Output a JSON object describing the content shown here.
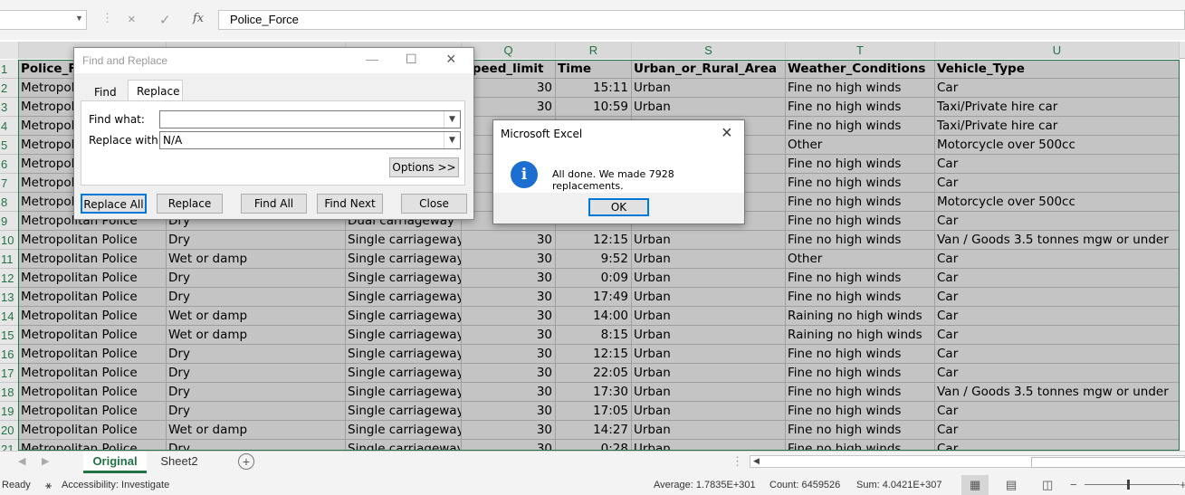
{
  "formula_bar": {
    "name_box_value": "",
    "formula_value": "Police_Force",
    "cancel_icon": "×",
    "enter_icon": "✓",
    "fx_icon": "fx"
  },
  "columns": [
    {
      "letter": "",
      "label": ""
    },
    {
      "letter": "",
      "label": ""
    },
    {
      "letter": "",
      "label": ""
    },
    {
      "letter": "Q",
      "label": "Q"
    },
    {
      "letter": "R",
      "label": "R"
    },
    {
      "letter": "S",
      "label": "S"
    },
    {
      "letter": "T",
      "label": "T"
    },
    {
      "letter": "U",
      "label": "U"
    }
  ],
  "header_row": [
    "Police_Force",
    "",
    "",
    "Speed_limit",
    "Time",
    "Urban_or_Rural_Area",
    "Weather_Conditions",
    "Vehicle_Type"
  ],
  "rows": [
    {
      "n": "2",
      "a": "Metropolitan Police",
      "b": "",
      "c": "",
      "speed": "30",
      "time": "15:11",
      "area": "Urban",
      "weather": "Fine no high winds",
      "vehicle": "Car"
    },
    {
      "n": "3",
      "a": "Metropolitan Police",
      "b": "",
      "c": "",
      "speed": "30",
      "time": "10:59",
      "area": "Urban",
      "weather": "Fine no high winds",
      "vehicle": "Taxi/Private hire car"
    },
    {
      "n": "4",
      "a": "Metropolitan Police",
      "b": "",
      "c": "",
      "speed": "",
      "time": "",
      "area": "",
      "weather": "Fine no high winds",
      "vehicle": "Taxi/Private hire car"
    },
    {
      "n": "5",
      "a": "Metropolitan Police",
      "b": "",
      "c": "",
      "speed": "",
      "time": "",
      "area": "",
      "weather": "Other",
      "vehicle": "Motorcycle over 500cc"
    },
    {
      "n": "6",
      "a": "Metropolitan Police",
      "b": "",
      "c": "",
      "speed": "",
      "time": "",
      "area": "",
      "weather": "Fine no high winds",
      "vehicle": "Car"
    },
    {
      "n": "7",
      "a": "Metropolitan Police",
      "b": "",
      "c": "",
      "speed": "",
      "time": "",
      "area": "",
      "weather": "Fine no high winds",
      "vehicle": "Car"
    },
    {
      "n": "8",
      "a": "Metropolitan Police",
      "b": "",
      "c": "",
      "speed": "",
      "time": "",
      "area": "",
      "weather": "Fine no high winds",
      "vehicle": "Motorcycle over 500cc"
    },
    {
      "n": "9",
      "a": "Metropolitan Police",
      "b": "Dry",
      "c": "Dual carriageway",
      "speed": "30",
      "time": "15:18",
      "area": "Urban",
      "weather": "Fine no high winds",
      "vehicle": "Car"
    },
    {
      "n": "10",
      "a": "Metropolitan Police",
      "b": "Dry",
      "c": "Single carriageway",
      "speed": "30",
      "time": "12:15",
      "area": "Urban",
      "weather": "Fine no high winds",
      "vehicle": "Van / Goods 3.5 tonnes mgw or under"
    },
    {
      "n": "11",
      "a": "Metropolitan Police",
      "b": "Wet or damp",
      "c": "Single carriageway",
      "speed": "30",
      "time": "9:52",
      "area": "Urban",
      "weather": "Other",
      "vehicle": "Car"
    },
    {
      "n": "12",
      "a": "Metropolitan Police",
      "b": "Dry",
      "c": "Single carriageway",
      "speed": "30",
      "time": "0:09",
      "area": "Urban",
      "weather": "Fine no high winds",
      "vehicle": "Car"
    },
    {
      "n": "13",
      "a": "Metropolitan Police",
      "b": "Dry",
      "c": "Single carriageway",
      "speed": "30",
      "time": "17:49",
      "area": "Urban",
      "weather": "Fine no high winds",
      "vehicle": "Car"
    },
    {
      "n": "14",
      "a": "Metropolitan Police",
      "b": "Wet or damp",
      "c": "Single carriageway",
      "speed": "30",
      "time": "14:00",
      "area": "Urban",
      "weather": "Raining no high winds",
      "vehicle": "Car"
    },
    {
      "n": "15",
      "a": "Metropolitan Police",
      "b": "Wet or damp",
      "c": "Single carriageway",
      "speed": "30",
      "time": "8:15",
      "area": "Urban",
      "weather": "Raining no high winds",
      "vehicle": "Car"
    },
    {
      "n": "16",
      "a": "Metropolitan Police",
      "b": "Dry",
      "c": "Single carriageway",
      "speed": "30",
      "time": "12:15",
      "area": "Urban",
      "weather": "Fine no high winds",
      "vehicle": "Car"
    },
    {
      "n": "17",
      "a": "Metropolitan Police",
      "b": "Dry",
      "c": "Single carriageway",
      "speed": "30",
      "time": "22:05",
      "area": "Urban",
      "weather": "Fine no high winds",
      "vehicle": "Car"
    },
    {
      "n": "18",
      "a": "Metropolitan Police",
      "b": "Dry",
      "c": "Single carriageway",
      "speed": "30",
      "time": "17:30",
      "area": "Urban",
      "weather": "Fine no high winds",
      "vehicle": "Van / Goods 3.5 tonnes mgw or under"
    },
    {
      "n": "19",
      "a": "Metropolitan Police",
      "b": "Dry",
      "c": "Single carriageway",
      "speed": "30",
      "time": "17:05",
      "area": "Urban",
      "weather": "Fine no high winds",
      "vehicle": "Car"
    },
    {
      "n": "20",
      "a": "Metropolitan Police",
      "b": "Wet or damp",
      "c": "Single carriageway",
      "speed": "30",
      "time": "14:27",
      "area": "Urban",
      "weather": "Fine no high winds",
      "vehicle": "Car"
    },
    {
      "n": "21",
      "a": "Metropolitan Police",
      "b": "Dry",
      "c": "Single carriageway",
      "speed": "30",
      "time": "0:28",
      "area": "Urban",
      "weather": "Fine no high winds",
      "vehicle": "Car"
    }
  ],
  "header_row_number": "1",
  "sheet_tabs": {
    "active": "Original",
    "other": "Sheet2",
    "add_icon": "+"
  },
  "status_bar": {
    "ready": "Ready",
    "accessibility": "Accessibility: Investigate",
    "average": "Average: 1.7835E+301",
    "count": "Count: 6459526",
    "sum": "Sum: 4.0421E+307"
  },
  "find_replace": {
    "title": "Find and Replace",
    "tab_find": "Find",
    "tab_replace": "Replace",
    "find_what_label": "Find what:",
    "find_what_value": "",
    "replace_with_label": "Replace with:",
    "replace_with_value": "N/A",
    "options_button": "Options >>",
    "replace_all_button": "Replace All",
    "replace_button": "Replace",
    "find_all_button": "Find All",
    "find_next_button": "Find Next",
    "close_button": "Close"
  },
  "message_box": {
    "title": "Microsoft Excel",
    "message": "All done. We made 7928 replacements.",
    "ok_button": "OK",
    "info_icon": "i"
  }
}
